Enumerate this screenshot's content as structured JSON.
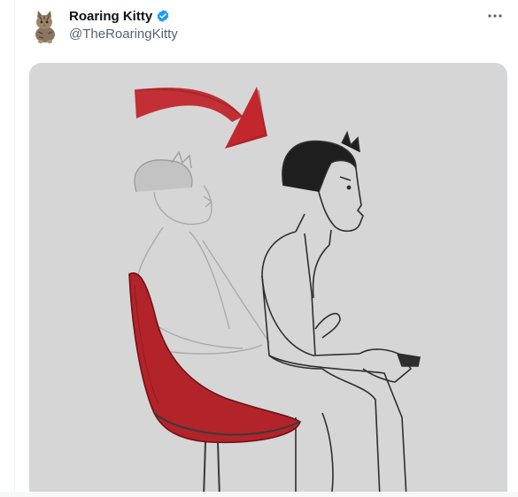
{
  "tweet": {
    "author": {
      "display_name": "Roaring Kitty",
      "handle": "@TheRoaringKitty",
      "verified_icon": "verified-badge-icon",
      "avatar_icon": "cat-avatar-icon"
    },
    "more_icon": "more-options-icon"
  },
  "colors": {
    "name": "#0f1419",
    "handle": "#536471",
    "verified": "#1d9bf0",
    "media_bg": "#d6d6d6",
    "arrow_red": "#c1272d",
    "chair_red": "#b3232a"
  }
}
